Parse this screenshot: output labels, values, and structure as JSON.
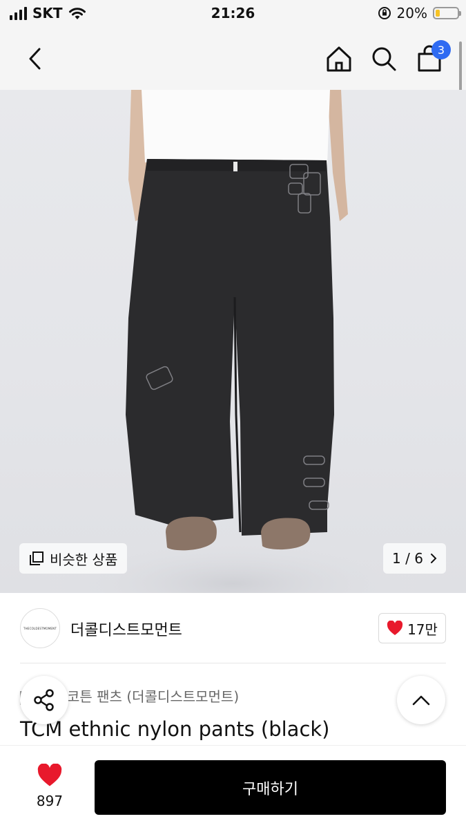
{
  "status_bar": {
    "carrier": "SKT",
    "time": "21:26",
    "battery_percent": "20%",
    "battery_level": 0.2
  },
  "nav": {
    "back_icon": "chevron-left-icon",
    "home_icon": "home-icon",
    "search_icon": "search-icon",
    "cart_icon": "shopping-bag-icon",
    "cart_badge": "3",
    "badge_color": "#2f6bf2"
  },
  "hero": {
    "similar_label": "비슷한 상품",
    "counter_current": "1",
    "counter_separator": "/",
    "counter_total": "6"
  },
  "shop": {
    "logo_text": "THECOLDESTMOMENT",
    "name": "더콜디스트모먼트",
    "likes": "17만"
  },
  "product": {
    "category": "코튼 팬츠 (더콜디스트모먼트)",
    "title": "TCM ethnic nylon pants (black)"
  },
  "bottom": {
    "wish_count": "897",
    "buy_label": "구매하기",
    "heart_color": "#e8192c"
  }
}
